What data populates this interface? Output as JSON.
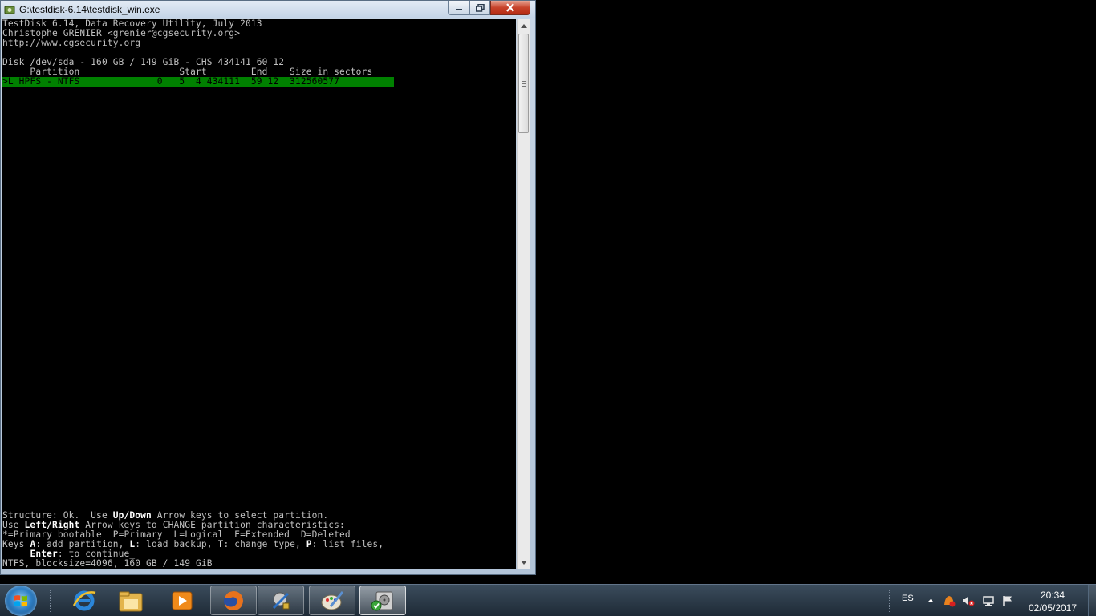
{
  "window": {
    "title": "G:\\testdisk-6.14\\testdisk_win.exe"
  },
  "console": {
    "header_line1": "TestDisk 6.14, Data Recovery Utility, July 2013",
    "header_line2": "Christophe GRENIER <grenier@cgsecurity.org>",
    "header_line3": "http://www.cgsecurity.org",
    "disk_info": "Disk /dev/sda - 160 GB / 149 GiB - CHS 434141 60 12",
    "column_headers": "     Partition                  Start        End    Size in sectors",
    "selected_partition": ">L HPFS - NTFS              0   5  4 434111  59 12  312560577",
    "help1": {
      "a": "Structure: Ok.  Use ",
      "b": "Up/Down",
      "c": " Arrow keys to select partition."
    },
    "help2": {
      "a": "Use ",
      "b": "Left/Right",
      "c": " Arrow keys to CHANGE partition characteristics:"
    },
    "help3": "*=Primary bootable  P=Primary  L=Logical  E=Extended  D=Deleted",
    "help4": {
      "a": "Keys ",
      "b": "A",
      "c": ": add partition, ",
      "d": "L",
      "e": ": load backup, ",
      "f": "T",
      "g": ": change type, ",
      "h": "P",
      "i": ": list files,"
    },
    "help5": {
      "a": "     ",
      "b": "Enter",
      "c": ": to continue_"
    },
    "status_line": "NTFS, blocksize=4096, 160 GB / 149 GiB"
  },
  "taskbar": {
    "items": [
      {
        "icon": "internet-explorer-icon"
      },
      {
        "icon": "file-explorer-icon"
      },
      {
        "icon": "media-player-icon"
      },
      {
        "icon": "firefox-icon"
      },
      {
        "icon": "tools-icon"
      },
      {
        "icon": "paint-icon"
      },
      {
        "icon": "testdisk-icon"
      }
    ],
    "language": "ES",
    "time": "20:34",
    "date": "02/05/2017"
  }
}
